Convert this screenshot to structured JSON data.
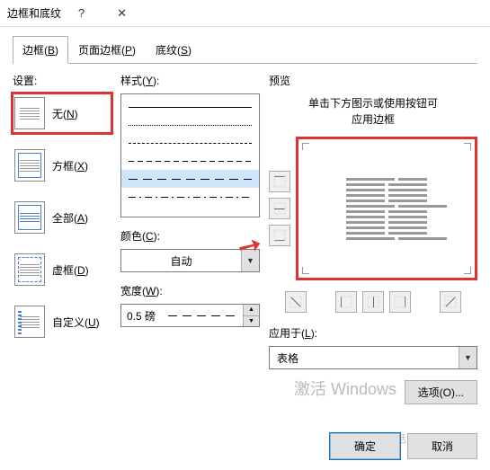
{
  "title": "边框和底纹",
  "titlebar": {
    "help": "?",
    "close": "✕"
  },
  "tabs": [
    {
      "label": "边框(",
      "key": "B",
      "suffix": ")"
    },
    {
      "label": "页面边框(",
      "key": "P",
      "suffix": ")"
    },
    {
      "label": "底纹(",
      "key": "S",
      "suffix": ")"
    }
  ],
  "sections": {
    "settings": "设置:",
    "style_label": "样式(",
    "style_key": "Y",
    "style_suffix": "):",
    "color_label": "颜色(",
    "color_key": "C",
    "color_suffix": "):",
    "width_label": "宽度(",
    "width_key": "W",
    "width_suffix": "):",
    "preview": "预览",
    "apply_label": "应用于(",
    "apply_key": "L",
    "apply_suffix": "):"
  },
  "settings_items": [
    {
      "label": "无(",
      "key": "N",
      "suffix": ")"
    },
    {
      "label": "方框(",
      "key": "X",
      "suffix": ")"
    },
    {
      "label": "全部(",
      "key": "A",
      "suffix": ")"
    },
    {
      "label": "虚框(",
      "key": "D",
      "suffix": ")"
    },
    {
      "label": "自定义(",
      "key": "U",
      "suffix": ")"
    }
  ],
  "color_value": "自动",
  "width_value": "0.5 磅",
  "preview_hint_line1": "单击下方图示或使用按钮可",
  "preview_hint_line2": "应用边框",
  "apply_value": "表格",
  "options_btn": "选项(O)...",
  "ok_btn": "确定",
  "cancel_btn": "取消",
  "watermark1": "激活 Windows",
  "watermark2": "转到\"设置\"以激活 Windows。"
}
